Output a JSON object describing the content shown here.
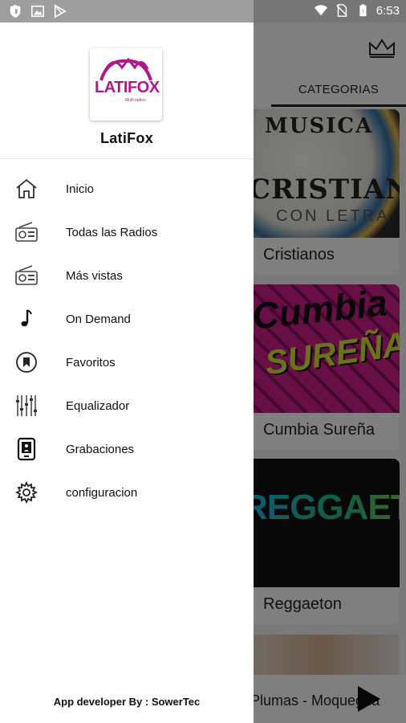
{
  "status_bar": {
    "time": "6:53",
    "left_icons": [
      "shield-icon",
      "image-icon",
      "play-store-icon"
    ],
    "right_icons": [
      "wifi-icon",
      "no-sim-icon",
      "battery-icon"
    ]
  },
  "drawer": {
    "logo_text": "LATIFOX",
    "logo_subtext": "Multi radios",
    "app_name": "LatiFox",
    "menu": [
      {
        "label": "Inicio",
        "icon": "home-icon"
      },
      {
        "label": "Todas las Radios",
        "icon": "radio-icon"
      },
      {
        "label": "Más vistas",
        "icon": "radio-icon"
      },
      {
        "label": "On Demand",
        "icon": "music-note-icon"
      },
      {
        "label": "Favoritos",
        "icon": "bookmark-icon"
      },
      {
        "label": "Equalizador",
        "icon": "equalizer-icon"
      },
      {
        "label": "Grabaciones",
        "icon": "recordings-icon"
      },
      {
        "label": "configuracion",
        "icon": "gear-icon"
      }
    ],
    "footer": "App developer By : SowerTec"
  },
  "background": {
    "tab_label": "CATEGORIAS",
    "cards": [
      {
        "title": "Cristianos",
        "img_line1": "MUSICA",
        "img_line2": "CRISTIANA",
        "img_line3": "CON LETRA"
      },
      {
        "title": "Cumbia Sureña",
        "img_line1": "Cumbia",
        "img_line2": "SUREÑA"
      },
      {
        "title": "Reggaeton",
        "img_line1": "REGGAETON"
      }
    ],
    "now_playing": "Plumas - Moquegua"
  },
  "colors": {
    "accent": "#b0178c",
    "scrim": "rgba(0,0,0,0.5)"
  }
}
